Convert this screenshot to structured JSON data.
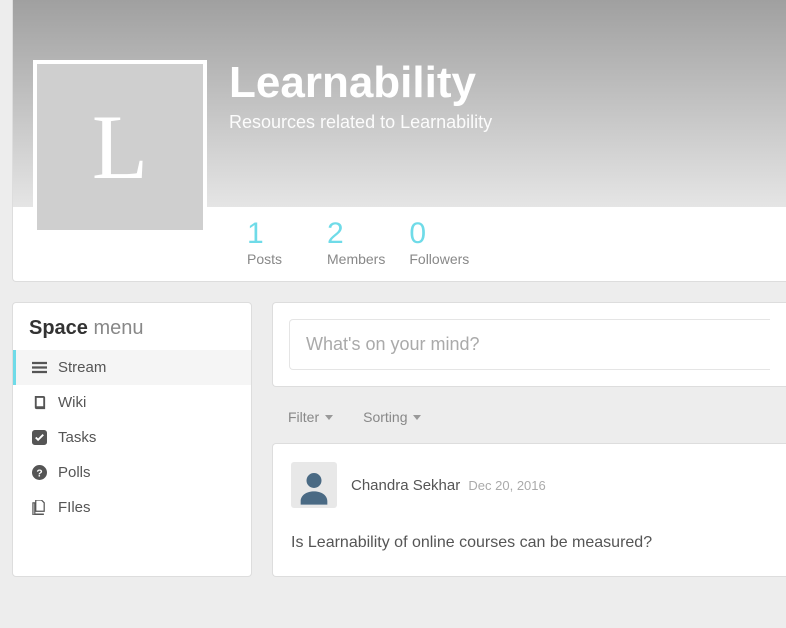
{
  "banner": {
    "avatar_letter": "L",
    "title": "Learnability",
    "subtitle": "Resources related to Learnability"
  },
  "stats": [
    {
      "value": "1",
      "label": "Posts"
    },
    {
      "value": "2",
      "label": "Members"
    },
    {
      "value": "0",
      "label": "Followers"
    }
  ],
  "sidebar": {
    "title_strong": "Space",
    "title_light": "menu",
    "items": [
      {
        "label": "Stream",
        "icon": "bars",
        "active": true
      },
      {
        "label": "Wiki",
        "icon": "book",
        "active": false
      },
      {
        "label": "Tasks",
        "icon": "check-square",
        "active": false
      },
      {
        "label": "Polls",
        "icon": "question-circle",
        "active": false
      },
      {
        "label": "FIles",
        "icon": "files",
        "active": false
      }
    ]
  },
  "composer": {
    "placeholder": "What's on your mind?"
  },
  "filters": {
    "filter_label": "Filter",
    "sorting_label": "Sorting"
  },
  "post": {
    "author": "Chandra Sekhar",
    "date": "Dec 20, 2016",
    "body": "Is Learnability of online courses can be measured?"
  }
}
